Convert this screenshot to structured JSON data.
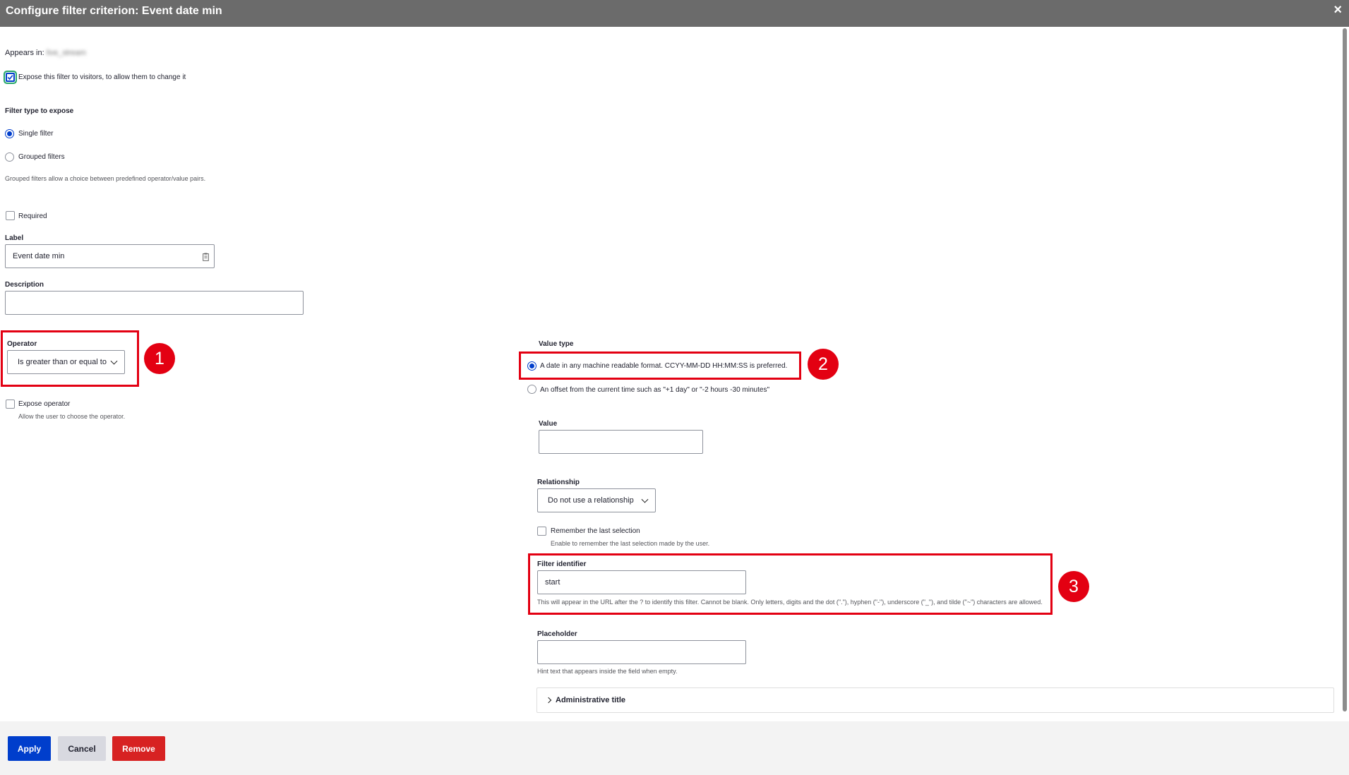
{
  "dialog": {
    "title": "Configure filter criterion: Event date min",
    "close_glyph": "×"
  },
  "appears_in": {
    "label": "Appears in:",
    "value": "live_stream"
  },
  "expose": {
    "label": "Expose this filter to visitors, to allow them to change it",
    "checked": true
  },
  "filter_type": {
    "heading": "Filter type to expose",
    "options": [
      "Single filter",
      "Grouped filters"
    ],
    "selected": "Single filter",
    "help": "Grouped filters allow a choice between predefined operator/value pairs."
  },
  "required": {
    "label": "Required",
    "checked": false
  },
  "label_field": {
    "label": "Label",
    "value": "Event date min"
  },
  "description_field": {
    "label": "Description",
    "value": ""
  },
  "operator": {
    "label": "Operator",
    "selected": "Is greater than or equal to",
    "expose_label": "Expose operator",
    "expose_help": "Allow the user to choose the operator."
  },
  "value_type": {
    "label": "Value type",
    "options": [
      "A date in any machine readable format. CCYY-MM-DD HH:MM:SS is preferred.",
      "An offset from the current time such as \"+1 day\" or \"-2 hours -30 minutes\""
    ],
    "selected_index": 0
  },
  "value_field": {
    "label": "Value",
    "value": ""
  },
  "relationship": {
    "label": "Relationship",
    "selected": "Do not use a relationship"
  },
  "remember": {
    "label": "Remember the last selection",
    "help": "Enable to remember the last selection made by the user.",
    "checked": false
  },
  "filter_identifier": {
    "label": "Filter identifier",
    "value": "start",
    "help": "This will appear in the URL after the ? to identify this filter. Cannot be blank. Only letters, digits and the dot (\".\"), hyphen (\"-\"), underscore (\"_\"), and tilde (\"~\") characters are allowed."
  },
  "placeholder_field": {
    "label": "Placeholder",
    "value": "",
    "help": "Hint text that appears inside the field when empty."
  },
  "admin_title": {
    "label": "Administrative title"
  },
  "annotations": [
    "1",
    "2",
    "3"
  ],
  "buttons": {
    "apply": "Apply",
    "cancel": "Cancel",
    "remove": "Remove"
  },
  "colors": {
    "primary": "#003ecc",
    "danger": "#d72222",
    "annotation": "#e30012",
    "titlebar": "#6b6b6b"
  }
}
